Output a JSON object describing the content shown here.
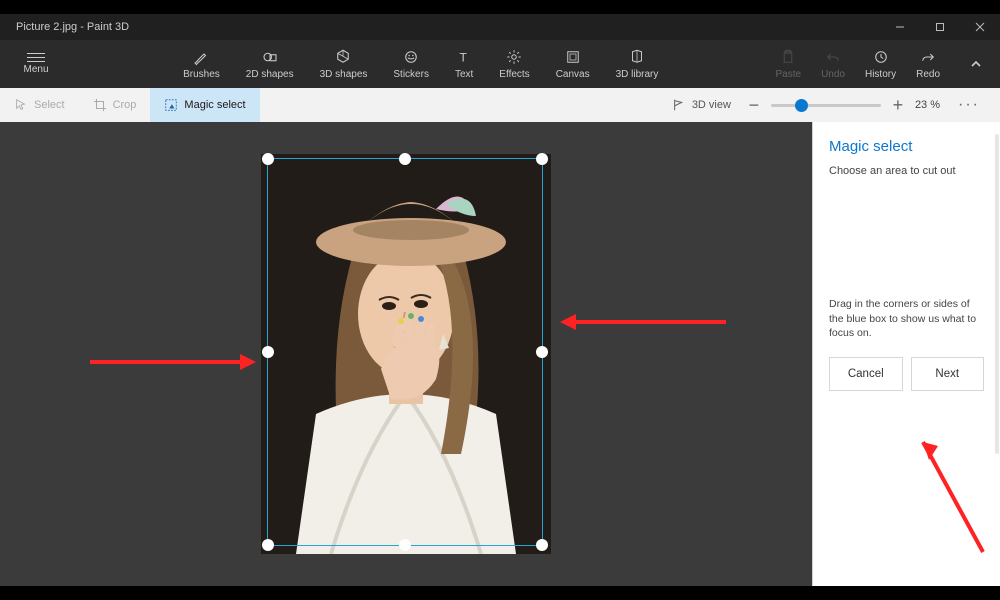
{
  "window": {
    "title": "Picture 2.jpg - Paint 3D"
  },
  "menu": {
    "label": "Menu"
  },
  "ribbon": {
    "brushes": "Brushes",
    "shapes2d": "2D shapes",
    "shapes3d": "3D shapes",
    "stickers": "Stickers",
    "text": "Text",
    "effects": "Effects",
    "canvas": "Canvas",
    "library3d": "3D library",
    "paste": "Paste",
    "undo": "Undo",
    "history": "History",
    "redo": "Redo"
  },
  "subbar": {
    "select": "Select",
    "crop": "Crop",
    "magic_select": "Magic select",
    "view3d": "3D view",
    "zoom_pct": "23 %"
  },
  "panel": {
    "title": "Magic select",
    "desc1": "Choose an area to cut out",
    "desc2": "Drag in the corners or sides of the blue box to show us what to focus on.",
    "cancel": "Cancel",
    "next": "Next"
  }
}
